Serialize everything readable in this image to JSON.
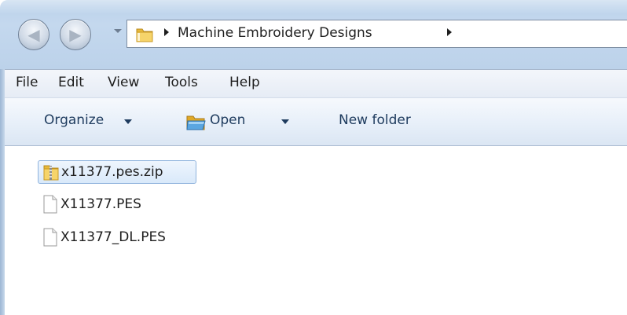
{
  "address": {
    "crumbs": [
      "Machine Embroidery Designs"
    ]
  },
  "menu": {
    "items": [
      "File",
      "Edit",
      "View",
      "Tools",
      "Help"
    ]
  },
  "commands": {
    "organize": "Organize",
    "open": "Open",
    "new_folder": "New folder"
  },
  "files": [
    {
      "name": "x11377.pes.zip",
      "icon": "zip-folder-icon",
      "selected": true
    },
    {
      "name": "X11377.PES",
      "icon": "file-icon",
      "selected": false
    },
    {
      "name": "X11377_DL.PES",
      "icon": "file-icon",
      "selected": false
    }
  ],
  "colors": {
    "chrome": "#bcd2ea",
    "selection": "#d9e9fa",
    "command_text": "#1e3b5e"
  }
}
